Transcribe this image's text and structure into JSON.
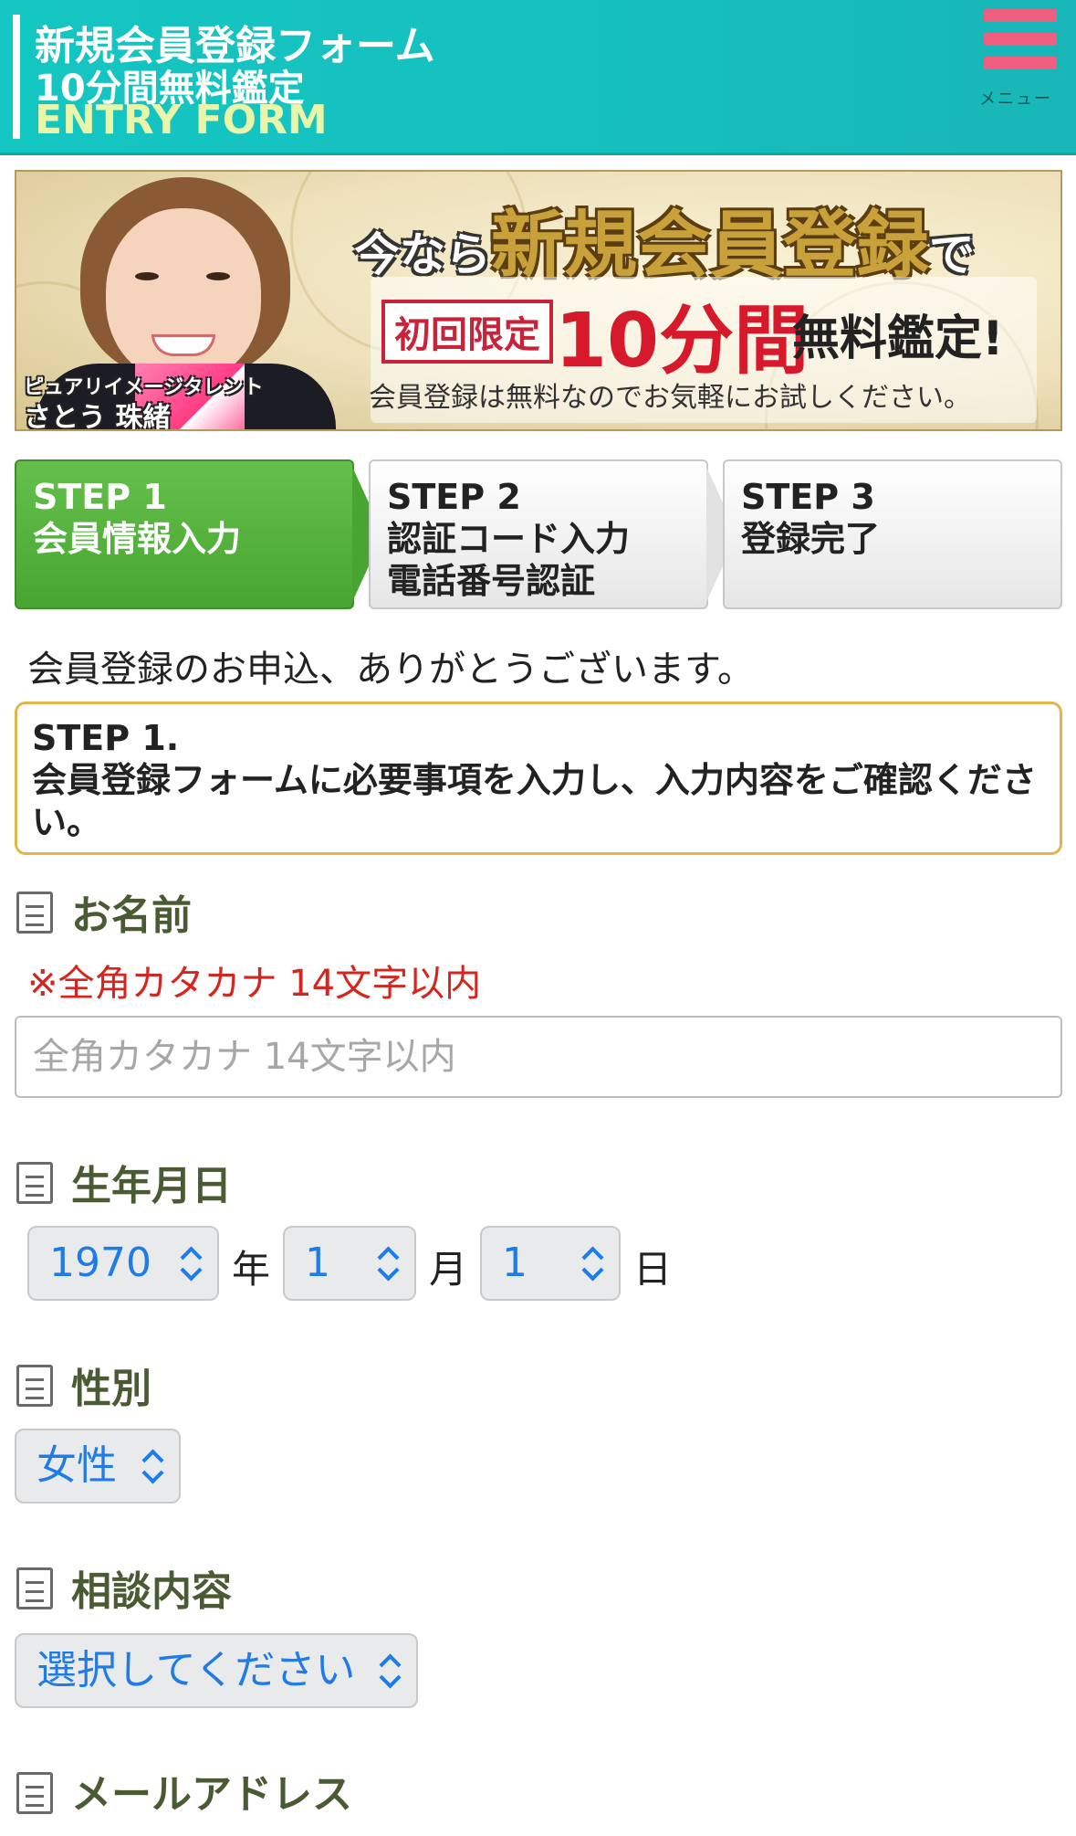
{
  "header": {
    "title_line1": "新規会員登録フォーム",
    "title_line2": "10分間無料鑑定",
    "title_line3": "ENTRY FORM",
    "menu_label": "メニュー",
    "icon": "hamburger-menu-icon",
    "background_color": "#16bfbd"
  },
  "banner": {
    "caption_line1": "ピュアリイメージタレント",
    "caption_line2": "さとう 珠緒",
    "headline_prefix": "今なら",
    "headline_main": "新規会員登録",
    "headline_suffix": "で",
    "limit_badge": "初回限定",
    "minutes": "10分間",
    "free_text": "無料鑑定!",
    "note": "会員登録は無料なのでお気軽にお試しください。"
  },
  "steps": [
    {
      "label": "STEP 1\n会員情報入力",
      "active": true
    },
    {
      "label": "STEP 2\n認証コード入力\n電話番号認証",
      "active": false
    },
    {
      "label": "STEP 3\n登録完了",
      "active": false
    }
  ],
  "thanks": "会員登録のお申込、ありがとうございます。",
  "notice": "STEP 1.\n会員登録フォームに必要事項を入力し、入力内容をご確認ください。",
  "fields": {
    "name": {
      "label": "お名前",
      "error": "※全角カタカナ 14文字以内",
      "placeholder": "全角カタカナ 14文字以内",
      "value": ""
    },
    "birthday": {
      "label": "生年月日",
      "year": "1970",
      "year_unit": "年",
      "month": "1",
      "month_unit": "月",
      "day": "1",
      "day_unit": "日"
    },
    "gender": {
      "label": "性別",
      "value": "女性"
    },
    "consultation": {
      "label": "相談内容",
      "value": "選択してください"
    },
    "email": {
      "label": "メールアドレス"
    }
  },
  "colors": {
    "accent_green": "#48a531",
    "error_red": "#d4251f",
    "select_blue": "#1f7be6",
    "label_olive": "#4a5a33",
    "notice_border": "#e2b44b",
    "menu_pink": "#ef5d7f"
  }
}
